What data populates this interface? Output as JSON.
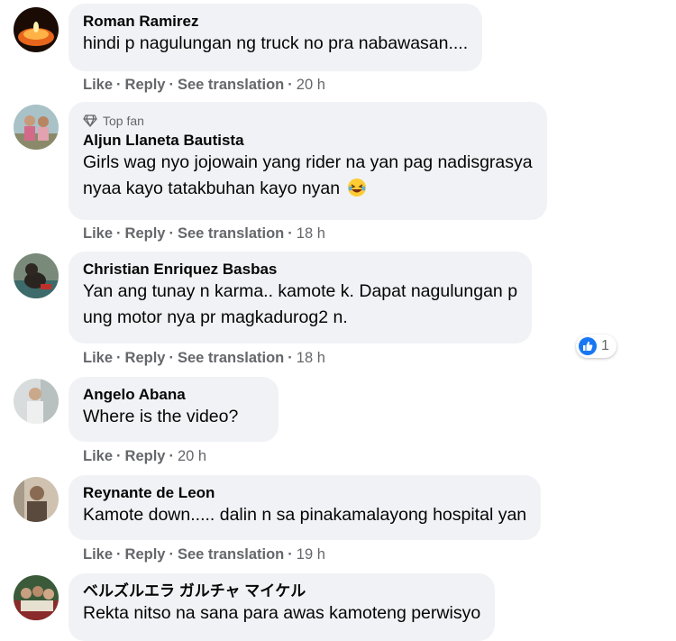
{
  "actions": {
    "like": "Like",
    "reply": "Reply",
    "see_translation": "See translation",
    "separator": "·"
  },
  "comments": [
    {
      "author": "Roman Ramirez",
      "text": [
        "hindi p nagulungan ng truck no pra nabawasan...."
      ],
      "time": "20 h",
      "avatar_icon": "candle-avatar"
    },
    {
      "badge": "Top fan",
      "badge_icon": "diamond-icon",
      "author": "Aljun Llaneta Bautista",
      "text": [
        "Girls wag nyo jojowain yang rider na yan pag nadisgrasya",
        "nyaa kayo tatakbuhan kayo nyan"
      ],
      "emoji_icon": "laughing-emoji-icon",
      "time": "18 h",
      "avatar_icon": "children-photo-avatar"
    },
    {
      "author": "Christian Enriquez Basbas",
      "text": [
        "Yan ang tunay n karma.. kamote k. Dapat nagulungan p",
        "ung motor nya pr magkadurog2 n."
      ],
      "time": "18 h",
      "reaction_count": "1",
      "reaction_icon": "like-reaction-icon",
      "avatar_icon": "dog-photo-avatar"
    },
    {
      "author": "Angelo Abana",
      "text": [
        "Where is the video?"
      ],
      "time": "20 h",
      "avatar_icon": "person-photo-avatar"
    },
    {
      "author": "Reynante de Leon",
      "text": [
        "Kamote down..... dalin n sa pinakamalayong hospital yan"
      ],
      "time": "19 h",
      "avatar_icon": "man-photo-avatar"
    },
    {
      "author": "ベルズルエラ ガルチャ マイケル",
      "text": [
        "Rekta nitso na sana para awas kamoteng perwisyo"
      ],
      "avatar_icon": "group-photo-avatar"
    }
  ],
  "colors": {
    "bubble_bg": "#f0f2f5",
    "secondary_text": "#65676b",
    "like_blue": "#1877f2"
  }
}
